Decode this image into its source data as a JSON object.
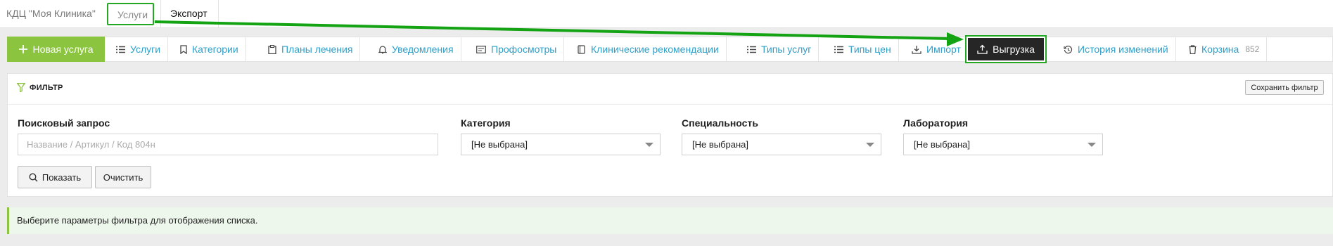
{
  "top": {
    "clinic_name": "КДЦ \"Моя Клиника\"",
    "tabs": [
      {
        "label": "Услуги"
      },
      {
        "label": "Экспорт"
      }
    ]
  },
  "toolbar": {
    "new_service_label": "Новая услуга",
    "items": [
      {
        "label": "Услуги",
        "icon": "list-icon"
      },
      {
        "label": "Категории",
        "icon": "bookmark-icon"
      },
      {
        "label": "Планы лечения",
        "icon": "clipboard-icon"
      },
      {
        "label": "Уведомления",
        "icon": "bell-icon"
      },
      {
        "label": "Профосмотры",
        "icon": "id-card-icon"
      },
      {
        "label": "Клинические рекомендации",
        "icon": "book-icon"
      },
      {
        "label": "Типы услуг",
        "icon": "list-icon"
      },
      {
        "label": "Типы цен",
        "icon": "list-icon"
      },
      {
        "label": "Импорт",
        "icon": "download-icon"
      }
    ],
    "export_label": "Выгрузка",
    "history_label": "История изменений",
    "trash_label": "Корзина",
    "trash_count": "852"
  },
  "filter": {
    "title": "ФИЛЬТР",
    "save_label": "Сохранить фильтр",
    "search_label": "Поисковый запрос",
    "search_placeholder": "Название / Артикул / Код 804н",
    "category_label": "Категория",
    "category_value": "[Не выбрана]",
    "specialty_label": "Специальность",
    "specialty_value": "[Не выбрана]",
    "laboratory_label": "Лаборатория",
    "laboratory_value": "[Не выбрана]",
    "show_label": "Показать",
    "clear_label": "Очистить"
  },
  "alert_text": "Выберите параметры фильтра для отображения списка.",
  "colors": {
    "accent_green": "#8bc43f",
    "link_blue": "#2f9fc8",
    "highlight_green": "#24a824",
    "export_dark": "#262626"
  }
}
